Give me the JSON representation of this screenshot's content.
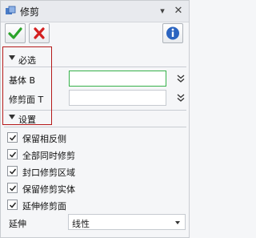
{
  "window": {
    "title": "修剪",
    "pin_glyph": "▾",
    "close_glyph": "✕"
  },
  "toolbar": {
    "ok": "confirm",
    "cancel": "cancel",
    "info": "info"
  },
  "required_section": {
    "title": "必选",
    "fields": [
      {
        "label": "基体 B",
        "value": ""
      },
      {
        "label": "修剪面 T",
        "value": ""
      }
    ]
  },
  "settings_section": {
    "title": "设置",
    "checkboxes": [
      {
        "label": "保留相反侧",
        "checked": true
      },
      {
        "label": "全部同时修剪",
        "checked": true
      },
      {
        "label": "封口修剪区域",
        "checked": true
      },
      {
        "label": "保留修剪实体",
        "checked": true
      },
      {
        "label": "延伸修剪面",
        "checked": true
      }
    ],
    "extend": {
      "label": "延伸",
      "value": "线性"
    }
  },
  "colors": {
    "accent_green": "#36b24a",
    "red_outline": "#b51a1a",
    "cancel_red": "#d42020"
  }
}
